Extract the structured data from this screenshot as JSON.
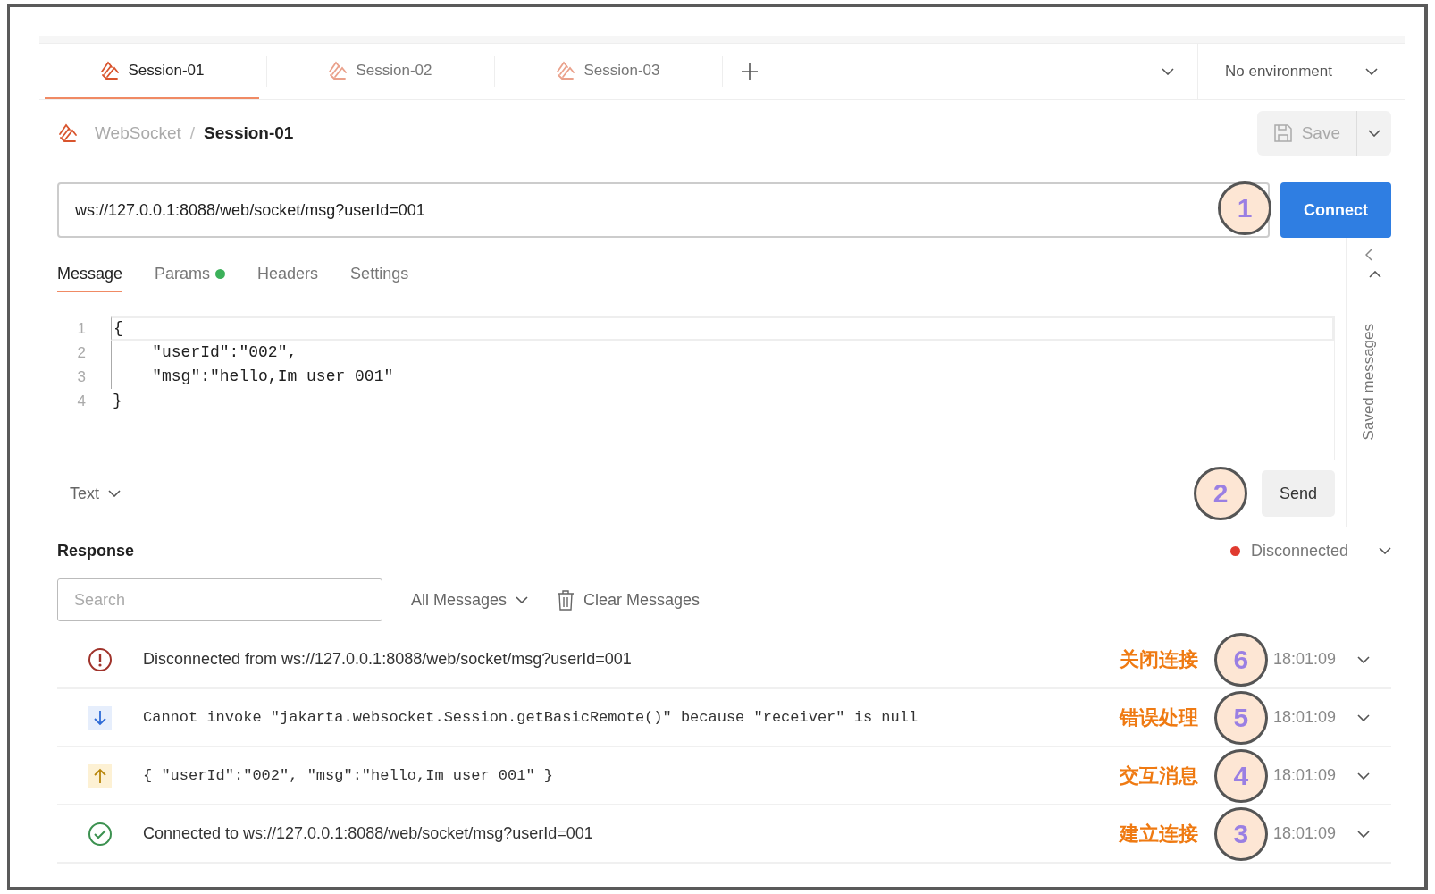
{
  "tabs": [
    {
      "label": "Session-01",
      "selected": true
    },
    {
      "label": "Session-02",
      "selected": false
    },
    {
      "label": "Session-03",
      "selected": false
    }
  ],
  "environment": "No environment",
  "breadcrumb": {
    "parent": "WebSocket",
    "separator": "/",
    "current": "Session-01"
  },
  "save_button": "Save",
  "url": {
    "value": "ws://127.0.0.1:8088/web/socket/msg?userId=001",
    "badge": "1"
  },
  "connect_button": "Connect",
  "request_tabs": [
    {
      "label": "Message",
      "selected": true,
      "dot": false
    },
    {
      "label": "Params",
      "selected": false,
      "dot": true
    },
    {
      "label": "Headers",
      "selected": false,
      "dot": false
    },
    {
      "label": "Settings",
      "selected": false,
      "dot": false
    }
  ],
  "editor": {
    "lines": [
      {
        "number": "1",
        "text": "{"
      },
      {
        "number": "2",
        "text": "    \"userId\":\"002\","
      },
      {
        "number": "3",
        "text": "    \"msg\":\"hello,Im user 001\""
      },
      {
        "number": "4",
        "text": "}"
      }
    ]
  },
  "saved_messages": "Saved messages",
  "format": "Text",
  "send": {
    "label": "Send",
    "badge": "2"
  },
  "response": {
    "title": "Response",
    "status": "Disconnected",
    "color": "#e03a2f"
  },
  "search": {
    "placeholder": "Search"
  },
  "filter": "All Messages",
  "clear": "Clear Messages",
  "messages": [
    {
      "kind": "error",
      "text": "Disconnected from ws://127.0.0.1:8088/web/socket/msg?userId=001",
      "note": "关闭连接",
      "badge": "6",
      "time": "18:01:09"
    },
    {
      "kind": "incoming",
      "text": "Cannot invoke \"jakarta.websocket.Session.getBasicRemote()\" because \"receiver\" is null",
      "note": "错误处理",
      "badge": "5",
      "time": "18:01:09"
    },
    {
      "kind": "outgoing",
      "text": "{ \"userId\":\"002\", \"msg\":\"hello,Im user 001\" }",
      "note": "交互消息",
      "badge": "4",
      "time": "18:01:09"
    },
    {
      "kind": "connected",
      "text": "Connected to ws://127.0.0.1:8088/web/socket/msg?userId=001",
      "note": "建立连接",
      "badge": "3",
      "time": "18:01:09"
    }
  ]
}
